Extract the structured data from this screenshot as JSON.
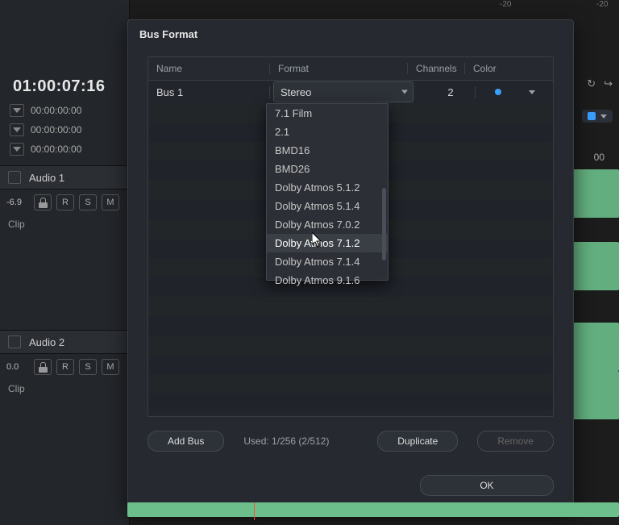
{
  "ruler": {
    "m20a": "-20",
    "m20b": "-20"
  },
  "timecode": {
    "main": "01:00:07:16",
    "rows": [
      "00:00:00:00",
      "00:00:00:00",
      "00:00:00:00"
    ]
  },
  "tracks": [
    {
      "id": "audio1",
      "name": "Audio 1",
      "level": "-6.9",
      "r": "R",
      "s": "S",
      "m": "M",
      "mode": "Clip"
    },
    {
      "id": "audio2",
      "name": "Audio 2",
      "level": "0.0",
      "r": "R",
      "s": "S",
      "m": "M",
      "mode": "Clip"
    }
  ],
  "right_icons": {
    "next_marker": "00"
  },
  "dialog": {
    "title": "Bus Format",
    "headers": {
      "name": "Name",
      "format": "Format",
      "channels": "Channels",
      "color": "Color"
    },
    "row": {
      "name": "Bus 1",
      "format_selected": "Stereo",
      "channels": "2"
    },
    "dropdown": {
      "items": [
        "7.1 Film",
        "2.1",
        "BMD16",
        "BMD26",
        "Dolby Atmos 5.1.2",
        "Dolby Atmos 5.1.4",
        "Dolby Atmos 7.0.2",
        "Dolby Atmos 7.1.2",
        "Dolby Atmos 7.1.4",
        "Dolby Atmos 9.1.6"
      ],
      "hover_index": 7
    },
    "footer": {
      "add_bus": "Add Bus",
      "used": "Used: 1/256  (2/512)",
      "duplicate": "Duplicate",
      "remove": "Remove",
      "ok": "OK"
    }
  }
}
